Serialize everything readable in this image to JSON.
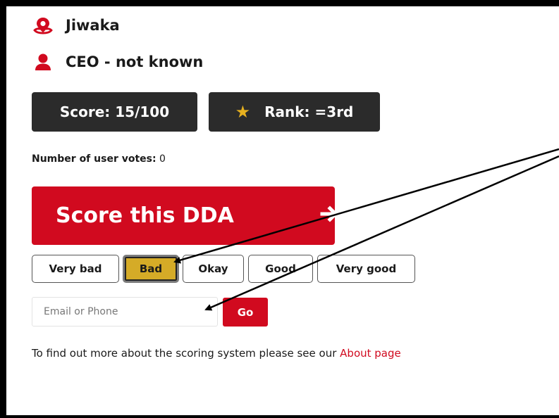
{
  "profile": {
    "location": "Jiwaka",
    "ceo": "CEO - not known"
  },
  "stats": {
    "score": "Score: 15/100",
    "rank": "Rank: =3rd",
    "votes_label": "Number of user votes:",
    "votes_value": "0"
  },
  "cta": {
    "label": "Score this DDA"
  },
  "ratings": [
    "Very bad",
    "Bad",
    "Okay",
    "Good",
    "Very good"
  ],
  "selected_rating": "Bad",
  "contact": {
    "placeholder": "Email or Phone",
    "go_label": "Go"
  },
  "footer": {
    "text": "To find out more about the scoring system please see our",
    "link_text": "About page"
  },
  "colors": {
    "accent": "#d10a1f",
    "dark": "#2b2b2b",
    "selected": "#d5ab27",
    "star": "#e7b11f"
  },
  "icons": [
    "map-pin-icon",
    "user-icon",
    "star-icon",
    "arrow-right-icon"
  ]
}
